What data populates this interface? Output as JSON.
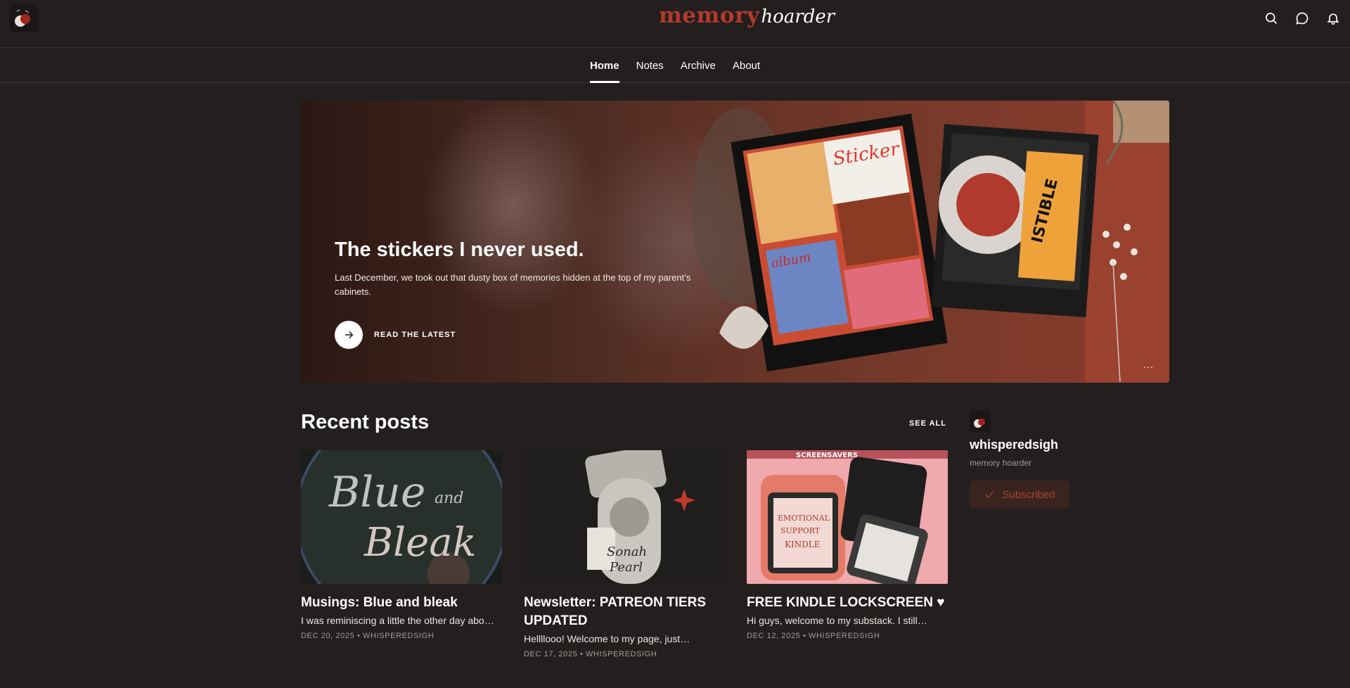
{
  "header": {
    "wordmark_part1": "memory",
    "wordmark_part2": "hoarder",
    "icons": [
      "search-icon",
      "chat-icon",
      "bell-icon"
    ]
  },
  "nav": {
    "tabs": [
      {
        "label": "Home",
        "active": true
      },
      {
        "label": "Notes",
        "active": false
      },
      {
        "label": "Archive",
        "active": false
      },
      {
        "label": "About",
        "active": false
      }
    ]
  },
  "hero": {
    "title": "The stickers I never used.",
    "subtitle": "Last December, we took out that dusty box of memories hidden at the top of my parent’s cabinets.",
    "cta_label": "READ THE LATEST",
    "more_label": "...",
    "collage_sticker_text": "Sticker",
    "collage_album_text": "album",
    "collage_tag_text": "ISTIBLE"
  },
  "recent": {
    "title": "Recent posts",
    "see_all": "SEE ALL",
    "posts": [
      {
        "title": "Musings: Blue and bleak",
        "subtitle": "I was reminiscing a little the other day abo…",
        "meta": "DEC 20, 2025 • WHISPEREDSIGH",
        "image_text_1": "Blue",
        "image_text_2": "and",
        "image_text_3": "Bleak"
      },
      {
        "title": "Newsletter: PATREON TIERS UPDATED",
        "subtitle": "Hellllooo! Welcome to my page, just…",
        "meta": "DEC 17, 2025 • WHISPEREDSIGH",
        "image_text_1": "Sonah",
        "image_text_2": "Pearl"
      },
      {
        "title": "FREE KINDLE LOCKSCREEN ♥",
        "subtitle": "Hi guys, welcome to my substack. I still…",
        "meta": "DEC 12, 2025 • WHISPEREDSIGH",
        "image_text_1": "SCREENSAVERS",
        "image_text_2": "EMOTIONAL",
        "image_text_3": "SUPPORT",
        "image_text_4": "KINDLE"
      }
    ]
  },
  "profile": {
    "name": "whisperedsigh",
    "tagline": "memory hoarder",
    "subscribe_label": "Subscribed"
  },
  "colors": {
    "background": "#231f1e",
    "brand": "#b23a2b",
    "subscribed_bg": "#3a2420",
    "subscribed_text": "#a84434"
  }
}
